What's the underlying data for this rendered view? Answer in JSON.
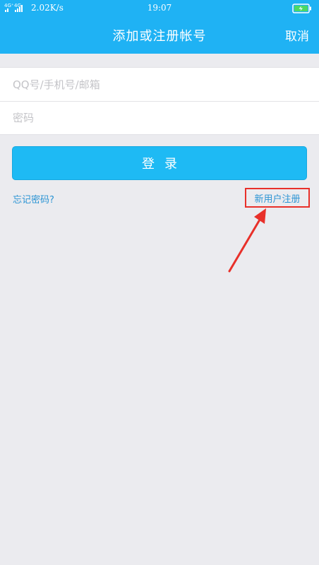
{
  "status_bar": {
    "network": "4G⁺ 4G",
    "speed": "2.02K/s",
    "time": "19:07",
    "battery_icon": "battery-charging-icon"
  },
  "header": {
    "title": "添加或注册帐号",
    "cancel_label": "取消"
  },
  "form": {
    "account_placeholder": "QQ号/手机号/邮箱",
    "password_placeholder": "密码"
  },
  "actions": {
    "login_label": "登录",
    "forgot_label": "忘记密码?",
    "register_label": "新用户注册"
  },
  "colors": {
    "accent": "#1fb2f4",
    "link": "#2b94d4",
    "annotation": "#e8302a",
    "background": "#ebebef"
  }
}
